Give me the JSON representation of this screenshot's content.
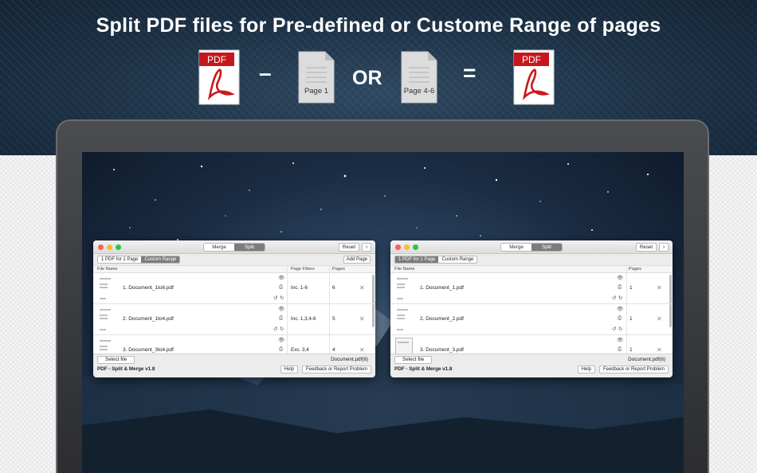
{
  "banner": {
    "headline": "Split PDF files for Pre-defined or Custome Range of pages",
    "pdf_badge": "PDF",
    "minus": "–",
    "or_word": "OR",
    "equals": "=",
    "page1_label": "Page 1",
    "page46_label": "Page 4-6",
    "pdf_red": "#c8171c"
  },
  "windows": [
    {
      "lights": [
        "#fe5f57",
        "#febc2e",
        "#28c840"
      ],
      "tabs": [
        "Merge",
        "Split"
      ],
      "active_tab": 1,
      "reset_label": "Reset",
      "next_label": "›",
      "modes": [
        "1 PDF for 1 Page",
        "Custom Range"
      ],
      "active_mode": 1,
      "add_page_label": "Add Page",
      "columns": {
        "file": "File Name",
        "filters": "Page Filters",
        "pages": "Pages"
      },
      "rows": [
        {
          "name": "1. Document_1to6.pdf",
          "filter": "Inc. 1-6",
          "pages": "6"
        },
        {
          "name": "2. Document_1to4.pdf",
          "filter": "Inc. 1,3,4-6",
          "pages": "5"
        },
        {
          "name": "3. Document_3to4.pdf",
          "filter": "Exc. 3,4",
          "pages": "4"
        }
      ],
      "select_file_label": "Select file",
      "doc_label": "Document.pdf(6)",
      "version": "PDF - Split & Merge v1.8",
      "help_label": "Help",
      "feedback_label": "Feedback or Report Problem"
    },
    {
      "lights": [
        "#fe5f57",
        "#febc2e",
        "#28c840"
      ],
      "tabs": [
        "Merge",
        "Split"
      ],
      "active_tab": 1,
      "reset_label": "Reset",
      "next_label": "›",
      "modes": [
        "1 PDF for 1 Page",
        "Custom Range"
      ],
      "active_mode": 0,
      "columns": {
        "file": "File Name",
        "pages": "Pages"
      },
      "rows": [
        {
          "name": "1. Document_1.pdf",
          "pages": "1"
        },
        {
          "name": "2. Document_2.pdf",
          "pages": "1"
        },
        {
          "name": "3. Document_3.pdf",
          "pages": "1"
        }
      ],
      "select_file_label": "Select file",
      "doc_label": "Document.pdf(6)",
      "version": "PDF - Split & Merge v1.8",
      "help_label": "Help",
      "feedback_label": "Feedback or Report Problem"
    }
  ],
  "icons": {
    "eye": "eye-icon",
    "printer": "printer-icon",
    "rotate": "rotate-icon",
    "delete": "close-icon"
  }
}
